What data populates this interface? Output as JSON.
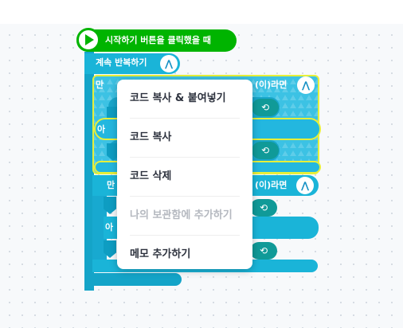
{
  "start_block": {
    "label": "시작하기 버튼을 클릭했을 때",
    "icon": "play-icon"
  },
  "repeat_block": {
    "label": "계속 반복하기",
    "icon": "branch-icon"
  },
  "if_blocks": [
    {
      "prefix": "만",
      "suffix": "(이)라면",
      "icon": "branch-icon"
    },
    {
      "prefix": "만",
      "suffix": "(이)라면",
      "icon": "branch-icon"
    }
  ],
  "else_fragments": [
    "아",
    "아"
  ],
  "context_menu": {
    "items": [
      {
        "label": "코드 복사 & 붙여넣기",
        "enabled": true
      },
      {
        "label": "코드 복사",
        "enabled": true
      },
      {
        "label": "코드 삭제",
        "enabled": true
      },
      {
        "label": "나의 보관함에 추가하기",
        "enabled": false
      },
      {
        "label": "메모 추가하기",
        "enabled": true
      }
    ]
  },
  "colors": {
    "start_block": "#00b400",
    "flow_block": "#1ab4d8",
    "highlight": "#e6ef3a",
    "menu_text": "#2c313d",
    "menu_text_disabled": "#b4b8bf"
  }
}
